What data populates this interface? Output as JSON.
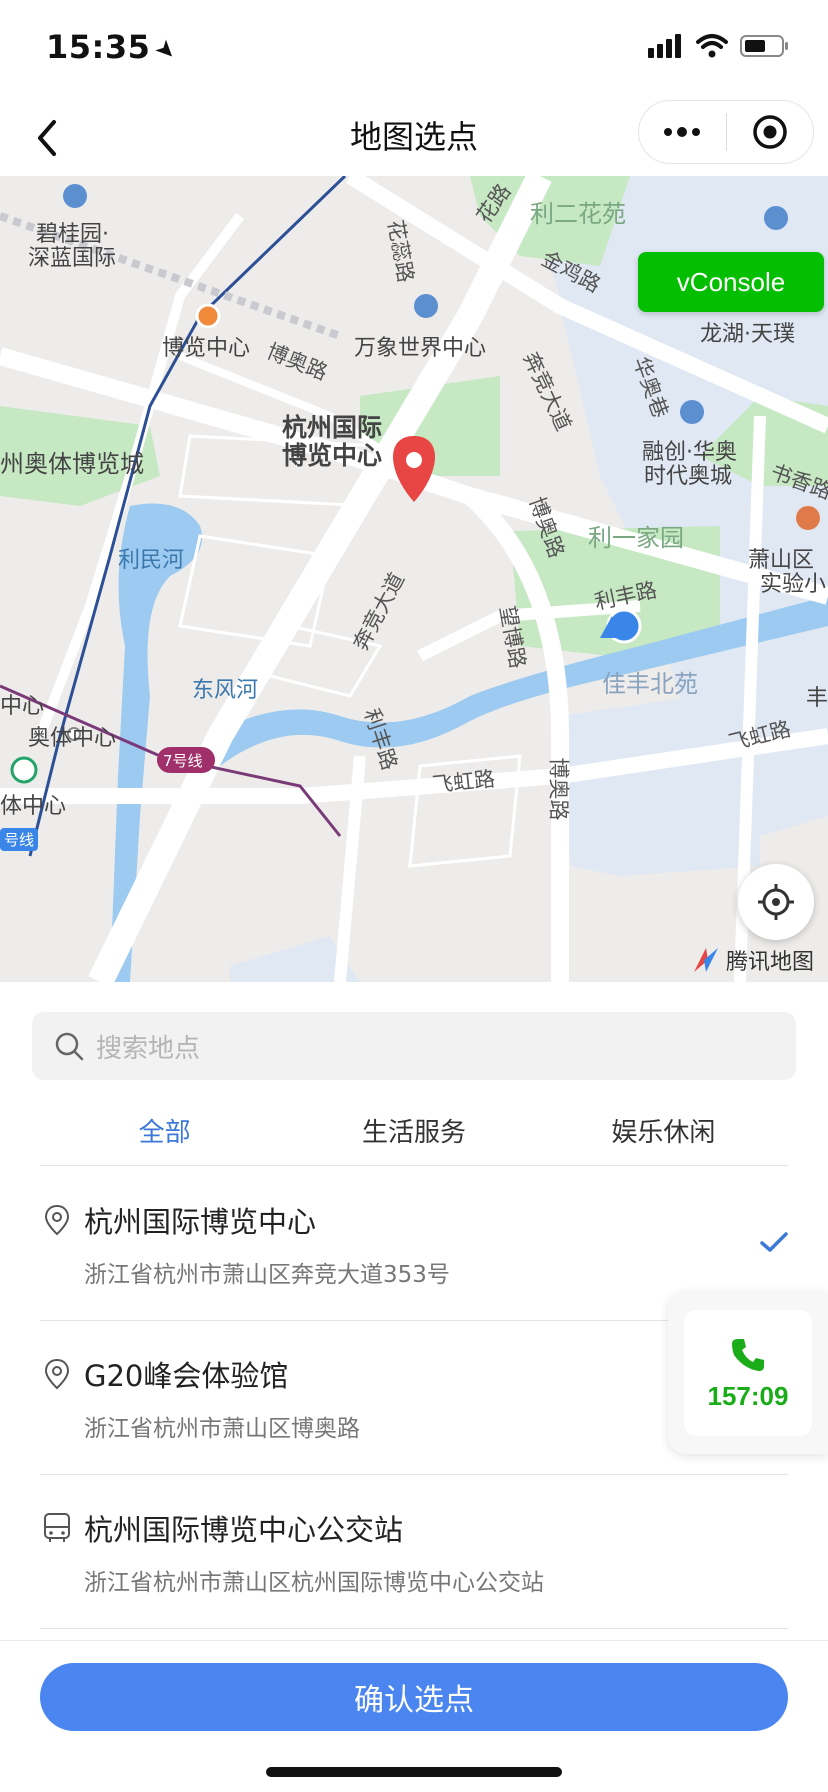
{
  "status_bar": {
    "time": "15:35",
    "icons": [
      "signal-icon",
      "wifi-icon",
      "battery-icon"
    ]
  },
  "nav": {
    "title": "地图选点",
    "icons": [
      "back-icon",
      "more-icon",
      "target-icon"
    ]
  },
  "map": {
    "overlay_button": "vConsole",
    "brand": "腾讯地图",
    "metro_line_badge": "7号线",
    "labels": {
      "p1": "利二花苑",
      "p2": "碧桂园·",
      "p3": "深蓝国际",
      "p4": "金鸡路",
      "p5": "龙湖·天璞",
      "p6": "博览中心",
      "p7": "万象世界中心",
      "p8": "博奥路",
      "p9": "奔竞大道",
      "p10": "杭州国际",
      "p11": "博览中心",
      "p12": "融创·华奥",
      "p13": "时代奥城",
      "p14": "州奥体博览城",
      "p15": "书香路",
      "p16": "利民河",
      "p17": "利一家园",
      "p18": "萧山区",
      "p19": "实验小",
      "p20": "博奥路",
      "p21": "奔竞大道",
      "p22": "利丰路",
      "p23": "望博路",
      "p24": "佳丰北苑",
      "p25": "东风河",
      "p26": "奥体中心",
      "p27": "利丰路",
      "p28": "飞虹路",
      "p29": "博奥路",
      "p30": "飞虹路",
      "p31": "体中心",
      "p32": "中心",
      "p33": "华奥巷",
      "p34": "丰",
      "p35": "花路",
      "p36": "号线",
      "p37": "花蕊路"
    }
  },
  "search": {
    "placeholder": "搜索地点"
  },
  "tabs": [
    "全部",
    "生活服务",
    "娱乐休闲"
  ],
  "results": [
    {
      "name": "杭州国际博览中心",
      "address": "浙江省杭州市萧山区奔竞大道353号",
      "icon": "location-pin-icon",
      "selected": true
    },
    {
      "name": "G20峰会体验馆",
      "address": "浙江省杭州市萧山区博奥路",
      "icon": "location-pin-icon",
      "selected": false
    },
    {
      "name": "杭州国际博览中心公交站",
      "address": "浙江省杭州市萧山区杭州国际博览中心公交站",
      "icon": "bus-icon",
      "selected": false
    }
  ],
  "call_float": {
    "time": "157:09",
    "icon": "phone-icon"
  },
  "confirm_button": "确认选点",
  "colors": {
    "accent_blue": "#4b86f0",
    "tab_active": "#3b78d8",
    "vconsole_green": "#04be02",
    "call_green": "#1aad19",
    "marker_red": "#e84545"
  }
}
